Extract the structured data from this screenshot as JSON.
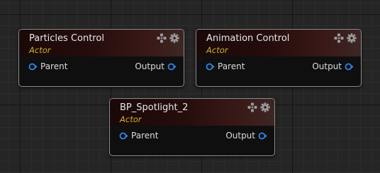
{
  "nodes": [
    {
      "title": "Particles Control",
      "subtitle": "Actor",
      "input_label": "Parent",
      "output_label": "Output",
      "icons": [
        "move-icon",
        "gear-icon"
      ]
    },
    {
      "title": "Animation Control",
      "subtitle": "Actor",
      "input_label": "Parent",
      "output_label": "Output",
      "icons": [
        "move-icon",
        "gear-icon"
      ]
    },
    {
      "title": "BP_Spotlight_2",
      "subtitle": "Actor",
      "input_label": "Parent",
      "output_label": "Output",
      "icons": [
        "move-icon",
        "gear-icon"
      ]
    }
  ],
  "colors": {
    "canvas": "#252525",
    "node_body": "#0f0f0f",
    "node_border": "#8c8c8c",
    "header_dark": "#1a0908",
    "header_light": "#3c2724",
    "title_text": "#e8e8e8",
    "subtitle_text": "#c8b233",
    "pin_color": "#2f86e8",
    "icon_color": "#9a9a9a"
  }
}
